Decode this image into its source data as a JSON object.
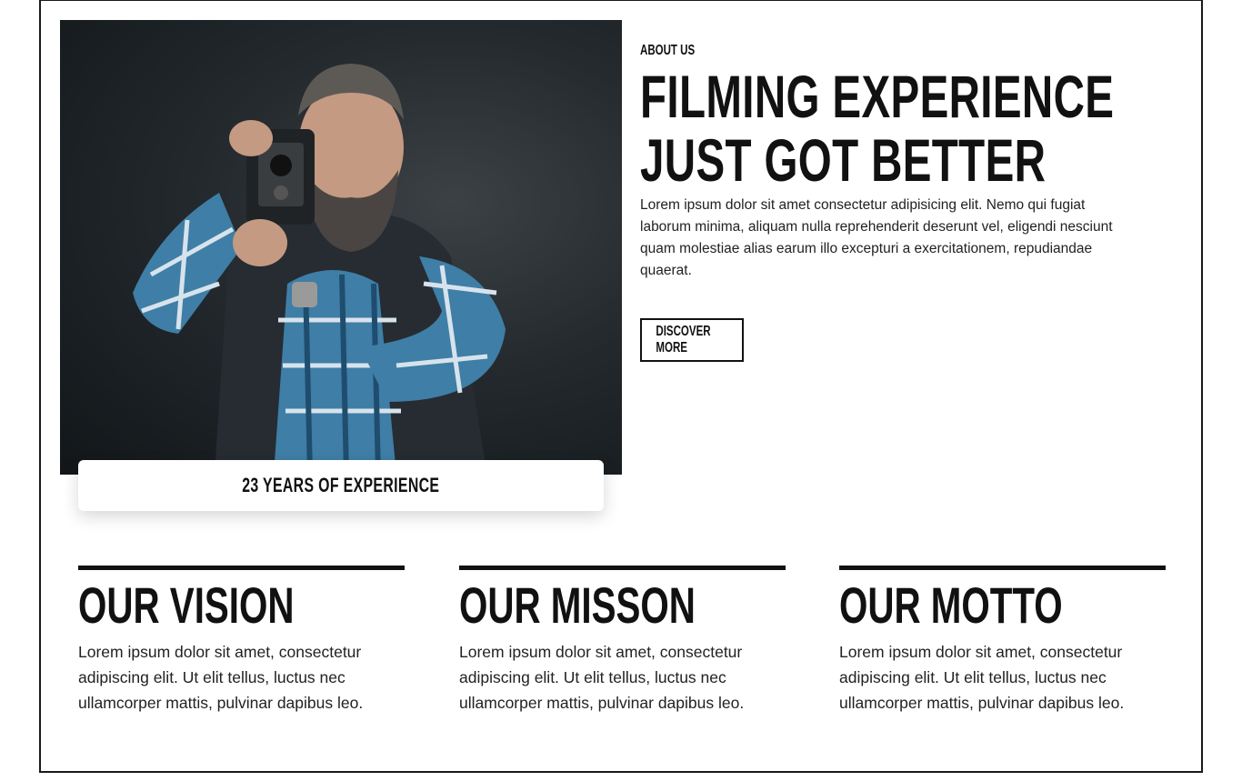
{
  "about": {
    "eyebrow": "ABOUT US",
    "headline_line1": "FILMING EXPERIENCE",
    "headline_line2": "JUST GOT BETTER",
    "paragraph": "Lorem ipsum dolor sit amet consectetur adipisicing elit. Nemo qui fugiat laborum minima, aliquam nulla reprehenderit deserunt vel, eligendi nesciunt quam molestiae alias earum illo excepturi a exercitationem, repudiandae quaerat.",
    "button_label": "DISCOVER MORE"
  },
  "experience_badge": "23 YEARS OF EXPERIENCE",
  "columns": [
    {
      "title": "OUR VISION",
      "text": "Lorem ipsum dolor sit amet, consectetur adipiscing elit. Ut elit tellus, luctus nec ullamcorper mattis, pulvinar dapibus leo."
    },
    {
      "title": "OUR MISSON",
      "text": "Lorem ipsum dolor sit amet, consectetur adipiscing elit. Ut elit tellus, luctus nec ullamcorper mattis, pulvinar dapibus leo."
    },
    {
      "title": "OUR MOTTO",
      "text": "Lorem ipsum dolor sit amet, consectetur adipiscing elit. Ut elit tellus, luctus nec ullamcorper mattis, pulvinar dapibus leo."
    }
  ],
  "colors": {
    "text": "#111111",
    "accent_bar": "#111111",
    "background": "#ffffff"
  }
}
